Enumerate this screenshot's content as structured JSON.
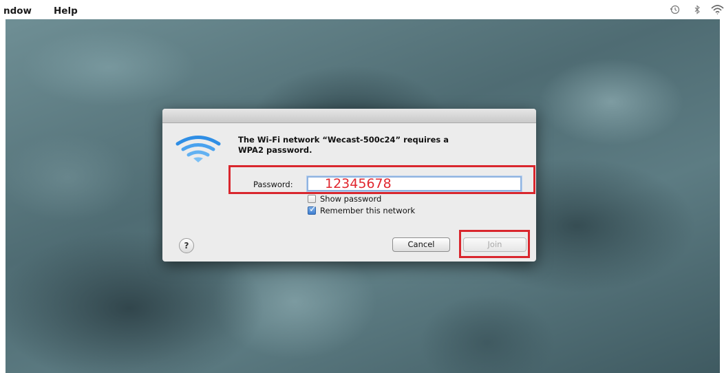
{
  "menubar": {
    "items": [
      "ndow",
      "Help"
    ],
    "status_icons": [
      "time-machine-icon",
      "bluetooth-icon",
      "wifi-icon"
    ]
  },
  "dialog": {
    "icon": "wifi-icon",
    "message_line1": "The Wi-Fi network “Wecast-500c24” requires a",
    "message_line2": "WPA2 password.",
    "password_label": "Password:",
    "password_value": "12345678",
    "show_password_label": "Show password",
    "show_password_checked": false,
    "remember_label": "Remember this network",
    "remember_checked": true,
    "help_label": "?",
    "cancel_label": "Cancel",
    "join_label": "Join",
    "join_enabled": false
  },
  "colors": {
    "highlight": "#d9262d",
    "password_text": "#e0262e",
    "wifi_icon": "#2f8ee5",
    "focus_ring": "#8fb3e0"
  }
}
